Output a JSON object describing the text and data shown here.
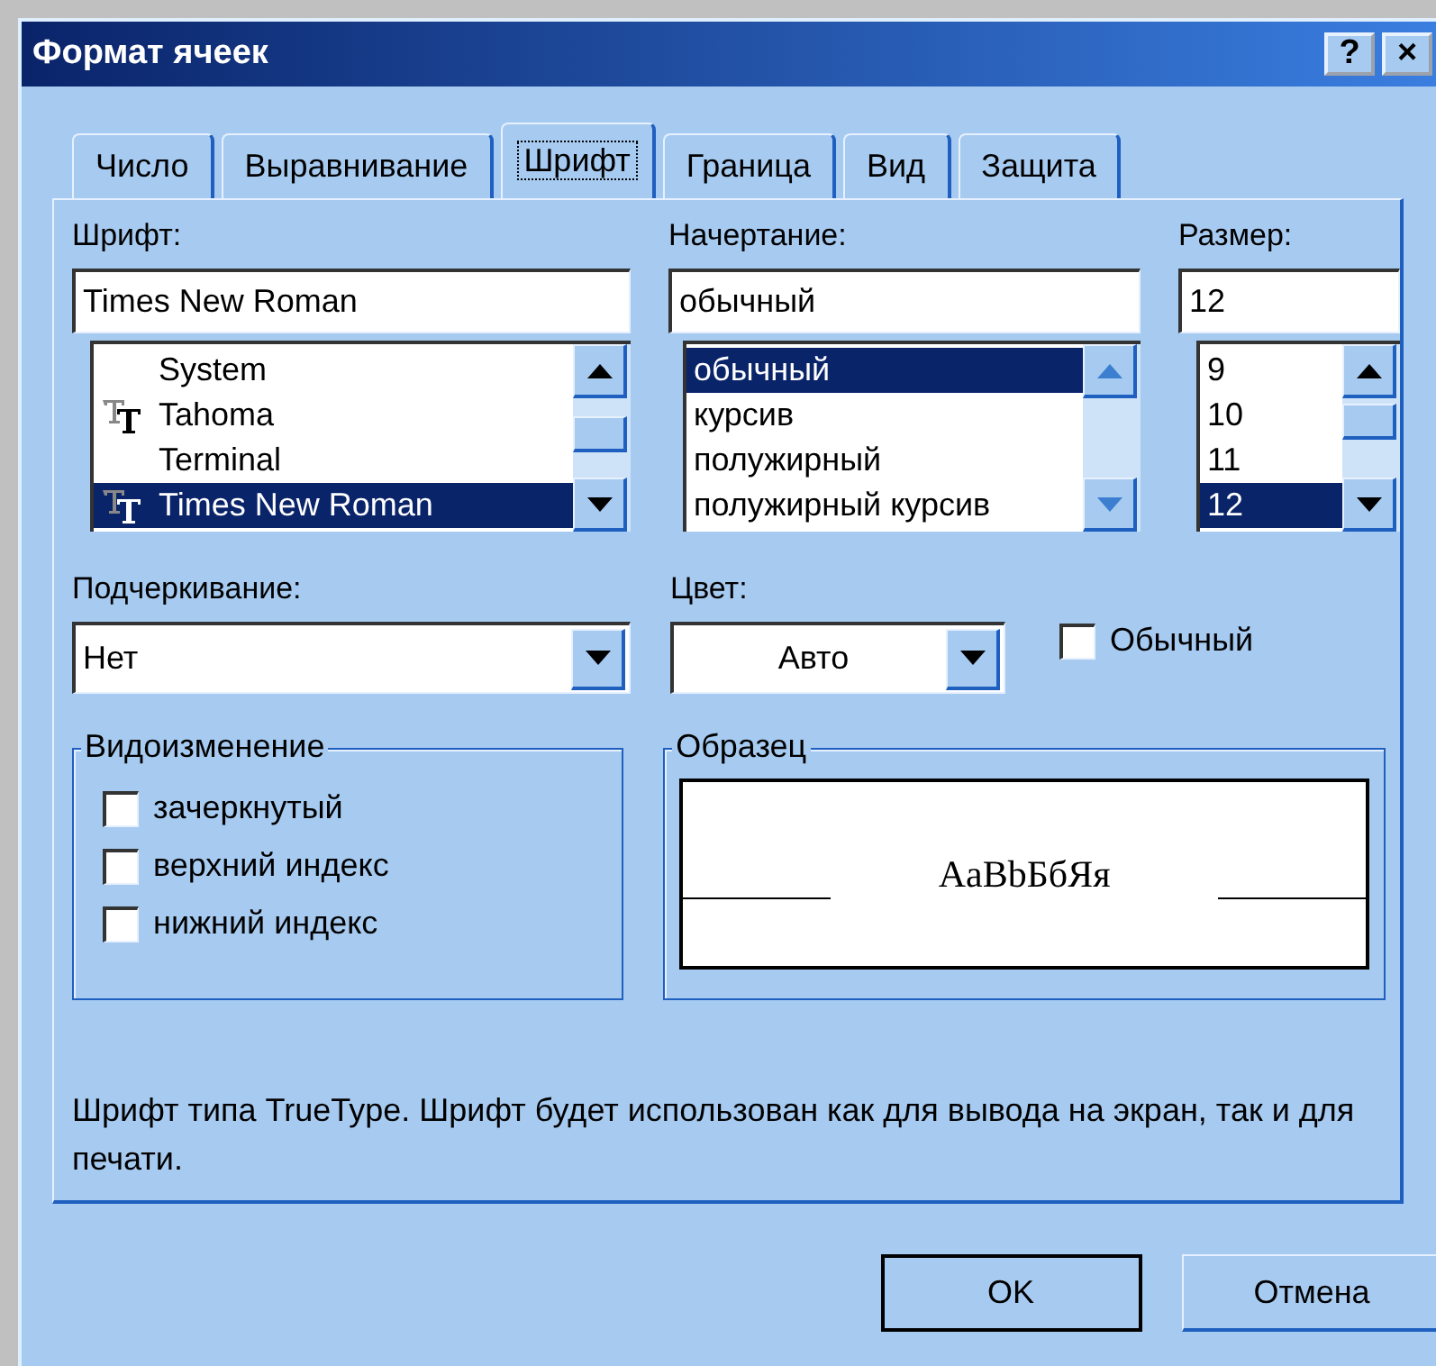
{
  "window": {
    "title": "Формат ячеек",
    "help_button": "?",
    "close_button": "×"
  },
  "tabs": [
    {
      "label": "Число",
      "selected": false
    },
    {
      "label": "Выравнивание",
      "selected": false
    },
    {
      "label": "Шрифт",
      "selected": true
    },
    {
      "label": "Граница",
      "selected": false
    },
    {
      "label": "Вид",
      "selected": false
    },
    {
      "label": "Защита",
      "selected": false
    }
  ],
  "font": {
    "label": "Шрифт:",
    "value": "Times New Roman",
    "scroll_enabled": true,
    "items": [
      {
        "label": "System",
        "truetype": false,
        "selected": false
      },
      {
        "label": "Tahoma",
        "truetype": true,
        "selected": false
      },
      {
        "label": "Terminal",
        "truetype": false,
        "selected": false
      },
      {
        "label": "Times New Roman",
        "truetype": true,
        "selected": true
      }
    ]
  },
  "style": {
    "label": "Начертание:",
    "value": "обычный",
    "scroll_enabled": false,
    "items": [
      {
        "label": "обычный",
        "selected": true
      },
      {
        "label": "курсив",
        "selected": false
      },
      {
        "label": "полужирный",
        "selected": false
      },
      {
        "label": "полужирный курсив",
        "selected": false
      }
    ]
  },
  "size": {
    "label": "Размер:",
    "value": "12",
    "scroll_enabled": true,
    "items": [
      {
        "label": "9",
        "selected": false
      },
      {
        "label": "10",
        "selected": false
      },
      {
        "label": "11",
        "selected": false
      },
      {
        "label": "12",
        "selected": true
      }
    ]
  },
  "underline": {
    "label": "Подчеркивание:",
    "value": "Нет"
  },
  "color": {
    "label": "Цвет:",
    "value": "Авто"
  },
  "normal_font": {
    "label": "Обычный",
    "checked": false
  },
  "effects": {
    "title": "Видоизменение",
    "items": [
      {
        "label": "зачеркнутый",
        "checked": false
      },
      {
        "label": "верхний индекс",
        "checked": false
      },
      {
        "label": "нижний индекс",
        "checked": false
      }
    ]
  },
  "preview": {
    "title": "Образец",
    "sample": "AaBbБбЯя"
  },
  "note": "Шрифт типа TrueType. Шрифт будет использован как для вывода на экран, так и для печати.",
  "buttons": [
    {
      "label": "OK",
      "default": true
    },
    {
      "label": "Отмена",
      "default": false
    }
  ]
}
